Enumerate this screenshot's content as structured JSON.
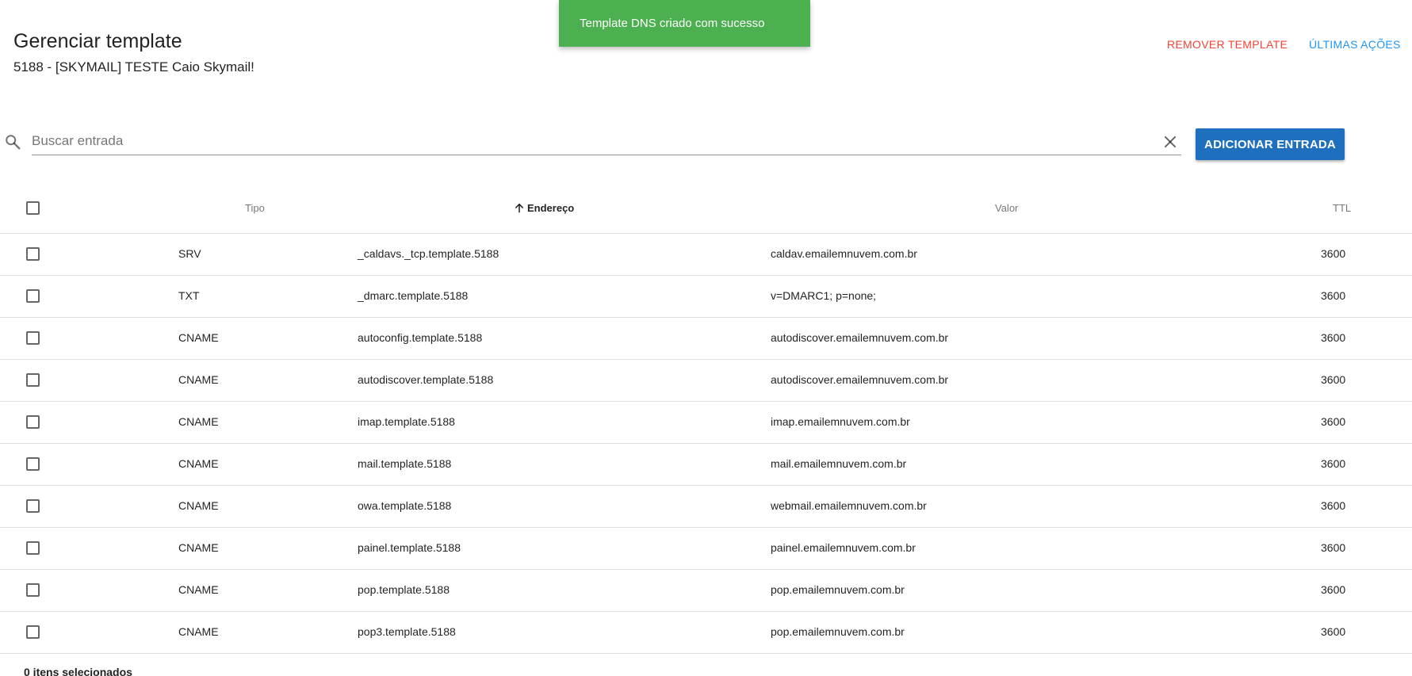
{
  "toast": {
    "message": "Template DNS criado com sucesso",
    "color": "#4caf50"
  },
  "header": {
    "title": "Gerenciar template",
    "subtitle": "5188 - [SKYMAIL] TESTE Caio Skymail!",
    "remove_label": "REMOVER TEMPLATE",
    "history_label": "ÚLTIMAS AÇÕES"
  },
  "search": {
    "placeholder": "Buscar entrada",
    "value": ""
  },
  "add_button_label": "ADICIONAR ENTRADA",
  "colors": {
    "primary": "#1e6fbd",
    "danger": "#f44336",
    "link": "#2196f3"
  },
  "table": {
    "columns": {
      "tipo": "Tipo",
      "endereco": "Endereço",
      "valor": "Valor",
      "ttl": "TTL"
    },
    "sort": {
      "column": "endereco",
      "direction": "asc",
      "icon": "arrow-up-icon"
    },
    "rows": [
      {
        "tipo": "SRV",
        "endereco": "_caldavs._tcp.template.5188",
        "valor": "caldav.emailemnuvem.com.br",
        "ttl": "3600"
      },
      {
        "tipo": "TXT",
        "endereco": "_dmarc.template.5188",
        "valor": "v=DMARC1; p=none;",
        "ttl": "3600"
      },
      {
        "tipo": "CNAME",
        "endereco": "autoconfig.template.5188",
        "valor": "autodiscover.emailemnuvem.com.br",
        "ttl": "3600"
      },
      {
        "tipo": "CNAME",
        "endereco": "autodiscover.template.5188",
        "valor": "autodiscover.emailemnuvem.com.br",
        "ttl": "3600"
      },
      {
        "tipo": "CNAME",
        "endereco": "imap.template.5188",
        "valor": "imap.emailemnuvem.com.br",
        "ttl": "3600"
      },
      {
        "tipo": "CNAME",
        "endereco": "mail.template.5188",
        "valor": "mail.emailemnuvem.com.br",
        "ttl": "3600"
      },
      {
        "tipo": "CNAME",
        "endereco": "owa.template.5188",
        "valor": "webmail.emailemnuvem.com.br",
        "ttl": "3600"
      },
      {
        "tipo": "CNAME",
        "endereco": "painel.template.5188",
        "valor": "painel.emailemnuvem.com.br",
        "ttl": "3600"
      },
      {
        "tipo": "CNAME",
        "endereco": "pop.template.5188",
        "valor": "pop.emailemnuvem.com.br",
        "ttl": "3600"
      },
      {
        "tipo": "CNAME",
        "endereco": "pop3.template.5188",
        "valor": "pop.emailemnuvem.com.br",
        "ttl": "3600"
      }
    ]
  },
  "footer": {
    "selection_text": "0 itens selecionados"
  }
}
